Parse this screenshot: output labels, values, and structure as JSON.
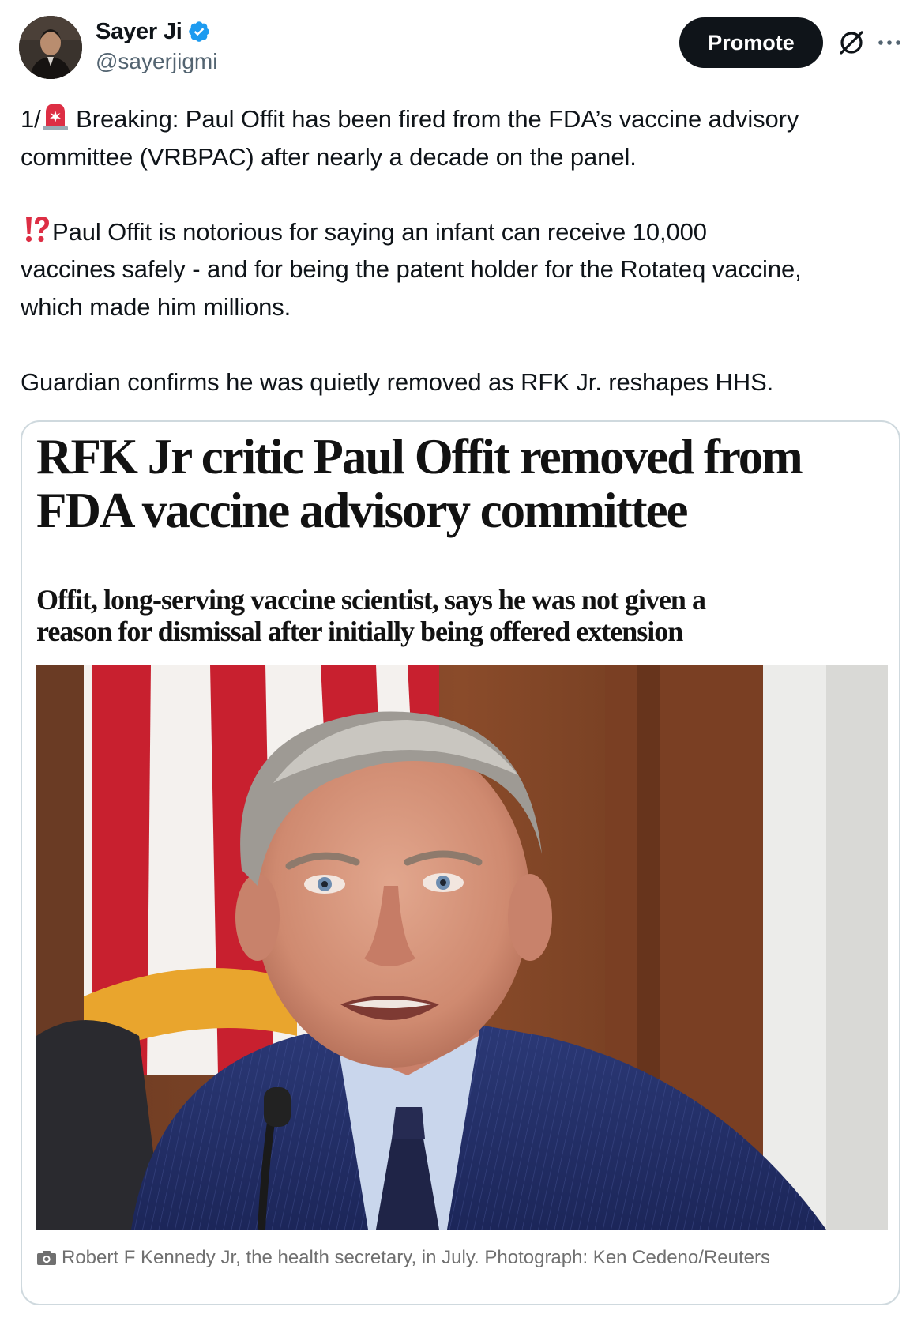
{
  "author": {
    "display_name": "Sayer Ji",
    "handle": "@sayerjigmi",
    "verified": true
  },
  "actions": {
    "promote_label": "Promote",
    "grok_icon": "grok-slash-circle-icon",
    "more_icon": "more-dots-icon"
  },
  "tweet": {
    "line1_a": "1/",
    "line1_b": " Breaking: Paul Offit has been fired from the FDA’s vaccine advisory",
    "line2": "committee (VRBPAC) after nearly a decade on the panel.",
    "line3": "Paul Offit is notorious for saying an infant can receive 10,000",
    "line4": "vaccines safely - and for being the patent holder for the Rotateq vaccine,",
    "line5": "which made him millions.",
    "line6": "Guardian confirms he was quietly removed as RFK Jr. reshapes HHS."
  },
  "card": {
    "headline_line1": "RFK Jr critic Paul Offit removed from",
    "headline_line2": "FDA vaccine advisory committee",
    "standfirst_line1": "Offit, long-serving vaccine scientist, says he was not given a",
    "standfirst_line2": "reason for dismissal after initially being offered extension",
    "photo_subject": "Robert F Kennedy Jr speaking at a microphone in front of a US flag",
    "caption": "Robert F Kennedy Jr, the health secretary, in July. Photograph: Ken Cedeno/Reuters"
  },
  "colors": {
    "text": "#0f1419",
    "secondary": "#536471",
    "verified_blue": "#1d9bf0",
    "card_border": "#cfd9de",
    "promote_bg": "#0f1419"
  }
}
